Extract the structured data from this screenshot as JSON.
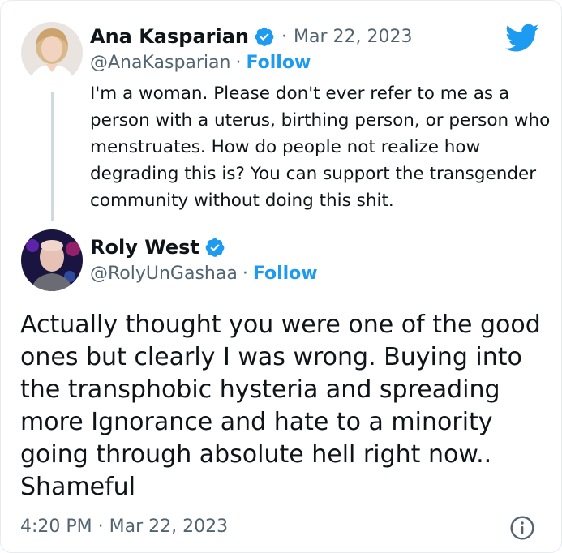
{
  "quoted_tweet": {
    "author_name": "Ana Kasparian",
    "separator_date": "·",
    "date": "Mar 22, 2023",
    "handle": "@AnaKasparian",
    "separator_follow": "·",
    "follow_label": "Follow",
    "text": "I'm a woman. Please don't ever refer to me as a person with a uterus, birthing person, or person who menstruates. How do people not realize how degrading this is? You can support the transgender community without doing this shit."
  },
  "reply_tweet": {
    "author_name": "Roly West",
    "handle": "@RolyUnGashaa",
    "separator_follow": "·",
    "follow_label": "Follow",
    "text": "Actually thought you were one of the good ones but clearly I was wrong. Buying into the transphobic hysteria and spreading more Ignorance and hate to a minority going through absolute hell right now.. Shameful"
  },
  "footer": {
    "timestamp": "4:20 PM · Mar 22, 2023"
  },
  "icons": {
    "brand": "twitter-bird-icon",
    "verified": "verified-badge-icon",
    "info": "info-icon"
  },
  "colors": {
    "brand_blue": "#1d9bf0",
    "verified_blue": "#1d9bf0",
    "secondary_text": "#536471",
    "primary_text": "#0f1419",
    "thread_line": "#cfd9de"
  }
}
